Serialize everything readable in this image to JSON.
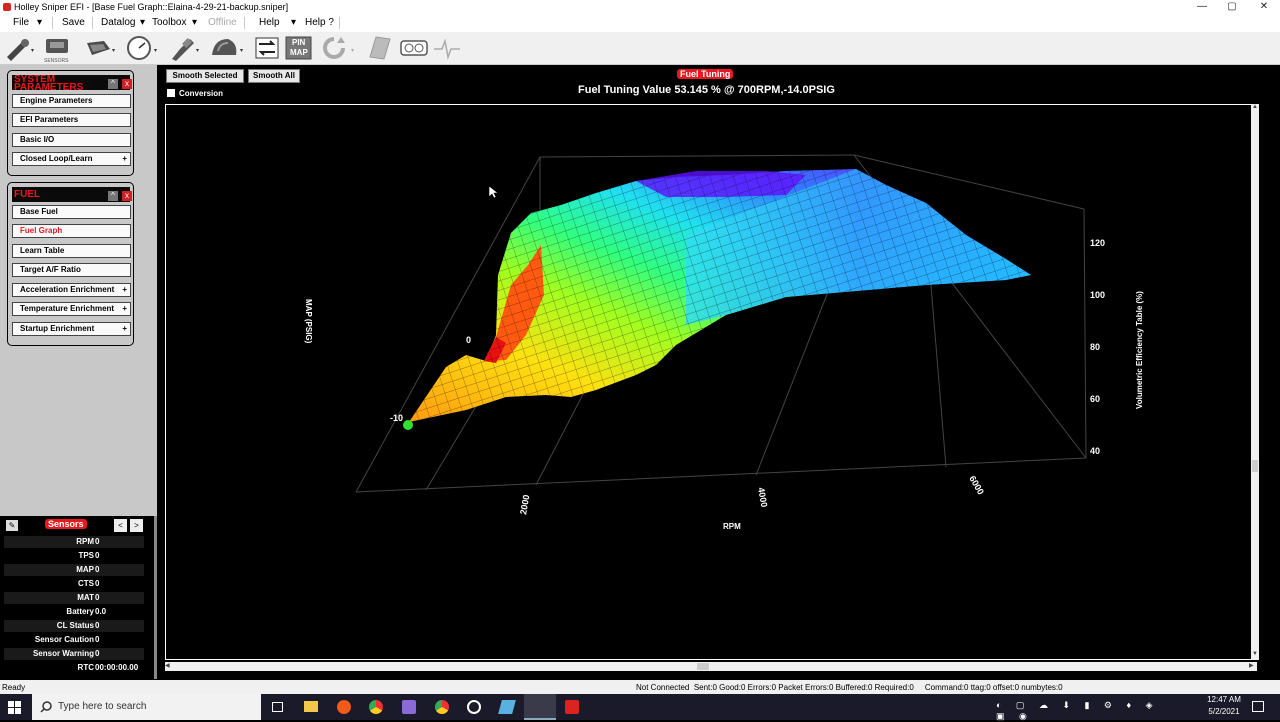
{
  "window": {
    "title": "Holley Sniper EFI - [Base Fuel Graph::Elaina-4-29-21-backup.sniper]",
    "min": "—",
    "max": "▢",
    "close": "✕"
  },
  "menu": {
    "file": "File",
    "save": "Save",
    "datalog": "Datalog",
    "toolbox": "Toolbox",
    "offline": "Offline",
    "help": "Help",
    "help_q": "Help ?"
  },
  "toolbar": {
    "sensors_caption": "SENSORS",
    "pin_map_1": "PIN",
    "pin_map_2": "MAP"
  },
  "sidebar": {
    "system_panel": {
      "title_line1": "SYSTEM",
      "title_line2": "PARAMETERS",
      "items": [
        {
          "label": "Engine Parameters"
        },
        {
          "label": "EFI Parameters"
        },
        {
          "label": "Basic I/O"
        },
        {
          "label": "Closed Loop/Learn",
          "plus": "+"
        }
      ]
    },
    "fuel_panel": {
      "title": "FUEL",
      "items": [
        {
          "label": "Base Fuel"
        },
        {
          "label": "Fuel Graph"
        },
        {
          "label": "Learn Table"
        },
        {
          "label": "Target A/F Ratio"
        },
        {
          "label": "Acceleration Enrichment",
          "plus": "+"
        },
        {
          "label": "Temperature Enrichment",
          "plus": "+"
        },
        {
          "label": "Startup Enrichment",
          "plus": "+"
        }
      ]
    },
    "collapse_glyph": "^",
    "close_glyph": "x"
  },
  "sensors": {
    "title": "Sensors",
    "prev": "<",
    "next": ">",
    "rows": [
      {
        "label": "RPM",
        "value": "0"
      },
      {
        "label": "TPS",
        "value": "0"
      },
      {
        "label": "MAP",
        "value": "0"
      },
      {
        "label": "CTS",
        "value": "0"
      },
      {
        "label": "MAT",
        "value": "0"
      },
      {
        "label": "Battery",
        "value": "0.0"
      },
      {
        "label": "CL Status",
        "value": "0"
      },
      {
        "label": "Sensor Caution",
        "value": "0"
      },
      {
        "label": "Sensor Warning",
        "value": "0"
      },
      {
        "label": "RTC",
        "value": "00:00:00.00"
      }
    ]
  },
  "main": {
    "smooth_selected": "Smooth Selected",
    "smooth_all": "Smooth All",
    "conversion": "Conversion",
    "graph_title": "Fuel Tuning",
    "graph_value": "Fuel Tuning Value 53.145 % @ 700RPM,-14.0PSIG"
  },
  "graph": {
    "map_label": "MAP (PSIG)",
    "rpm_label": "RPM",
    "ve_label": "Volumetric Efficiency Table (%)",
    "map_ticks": [
      "0",
      "-10"
    ],
    "rpm_ticks": [
      "2000",
      "4000",
      "6000"
    ],
    "ve_ticks": [
      "120",
      "100",
      "80",
      "60",
      "40"
    ]
  },
  "status": {
    "left": "Ready",
    "right": "Not Connected  Sent:0 Good:0 Errors:0 Packet Errors:0 Buffered:0 Required:0     Command:0 ttag:0 offset:0 numbytes:0"
  },
  "taskbar": {
    "search_placeholder": "Type here to search",
    "time": "12:47 AM",
    "date": "5/2/2021"
  },
  "colors": {
    "accent_red": "#e8181e",
    "panel_bg": "#c8c8c8",
    "graph_bg": "#000000"
  }
}
